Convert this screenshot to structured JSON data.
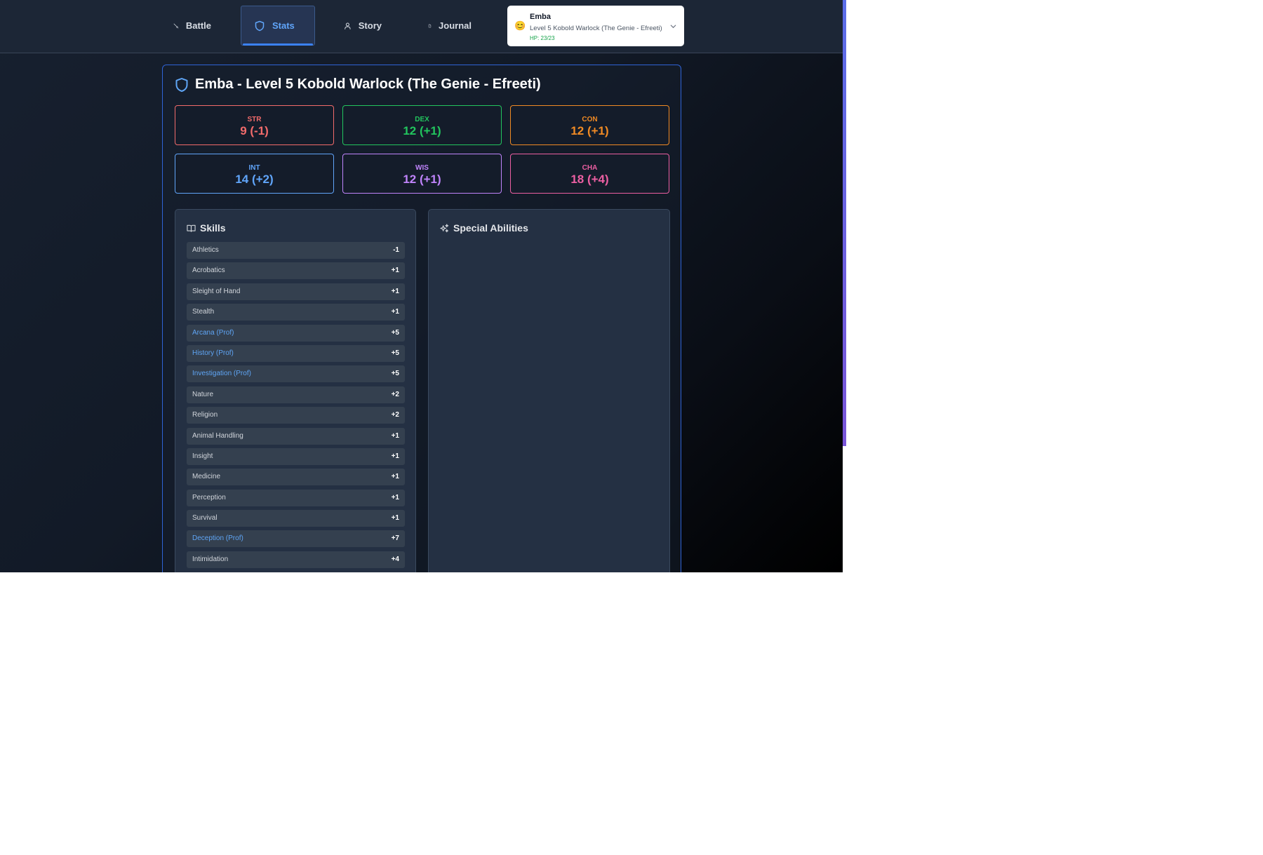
{
  "nav": {
    "tabs": [
      {
        "label": "Battle",
        "icon": "sword-icon"
      },
      {
        "label": "Stats",
        "icon": "shield-icon"
      },
      {
        "label": "Story",
        "icon": "person-icon"
      },
      {
        "label": "Journal",
        "icon": "document-icon"
      }
    ],
    "active_tab": "Stats"
  },
  "character_select": {
    "emoji": "😊",
    "name": "Emba",
    "description": "Level 5 Kobold Warlock (The Genie - Efreeti)",
    "hp": "HP: 23/23"
  },
  "panel": {
    "title": "Emba - Level 5 Kobold Warlock (The Genie - Efreeti)"
  },
  "abilities": [
    {
      "label": "STR",
      "value": "9 (-1)",
      "color": "#f26b6b"
    },
    {
      "label": "DEX",
      "value": "12 (+1)",
      "color": "#22c55e"
    },
    {
      "label": "CON",
      "value": "12 (+1)",
      "color": "#f08a24"
    },
    {
      "label": "INT",
      "value": "14 (+2)",
      "color": "#60a5fa"
    },
    {
      "label": "WIS",
      "value": "12 (+1)",
      "color": "#c084fc"
    },
    {
      "label": "CHA",
      "value": "18 (+4)",
      "color": "#ec5fa2"
    }
  ],
  "skills": {
    "title": "Skills",
    "items": [
      {
        "name": "Athletics",
        "mod": "-1",
        "proficient": false
      },
      {
        "name": "Acrobatics",
        "mod": "+1",
        "proficient": false
      },
      {
        "name": "Sleight of Hand",
        "mod": "+1",
        "proficient": false
      },
      {
        "name": "Stealth",
        "mod": "+1",
        "proficient": false
      },
      {
        "name": "Arcana (Prof)",
        "mod": "+5",
        "proficient": true
      },
      {
        "name": "History (Prof)",
        "mod": "+5",
        "proficient": true
      },
      {
        "name": "Investigation (Prof)",
        "mod": "+5",
        "proficient": true
      },
      {
        "name": "Nature",
        "mod": "+2",
        "proficient": false
      },
      {
        "name": "Religion",
        "mod": "+2",
        "proficient": false
      },
      {
        "name": "Animal Handling",
        "mod": "+1",
        "proficient": false
      },
      {
        "name": "Insight",
        "mod": "+1",
        "proficient": false
      },
      {
        "name": "Medicine",
        "mod": "+1",
        "proficient": false
      },
      {
        "name": "Perception",
        "mod": "+1",
        "proficient": false
      },
      {
        "name": "Survival",
        "mod": "+1",
        "proficient": false
      },
      {
        "name": "Deception (Prof)",
        "mod": "+7",
        "proficient": true
      },
      {
        "name": "Intimidation",
        "mod": "+4",
        "proficient": false
      }
    ]
  },
  "special_abilities": {
    "title": "Special Abilities",
    "items": []
  }
}
